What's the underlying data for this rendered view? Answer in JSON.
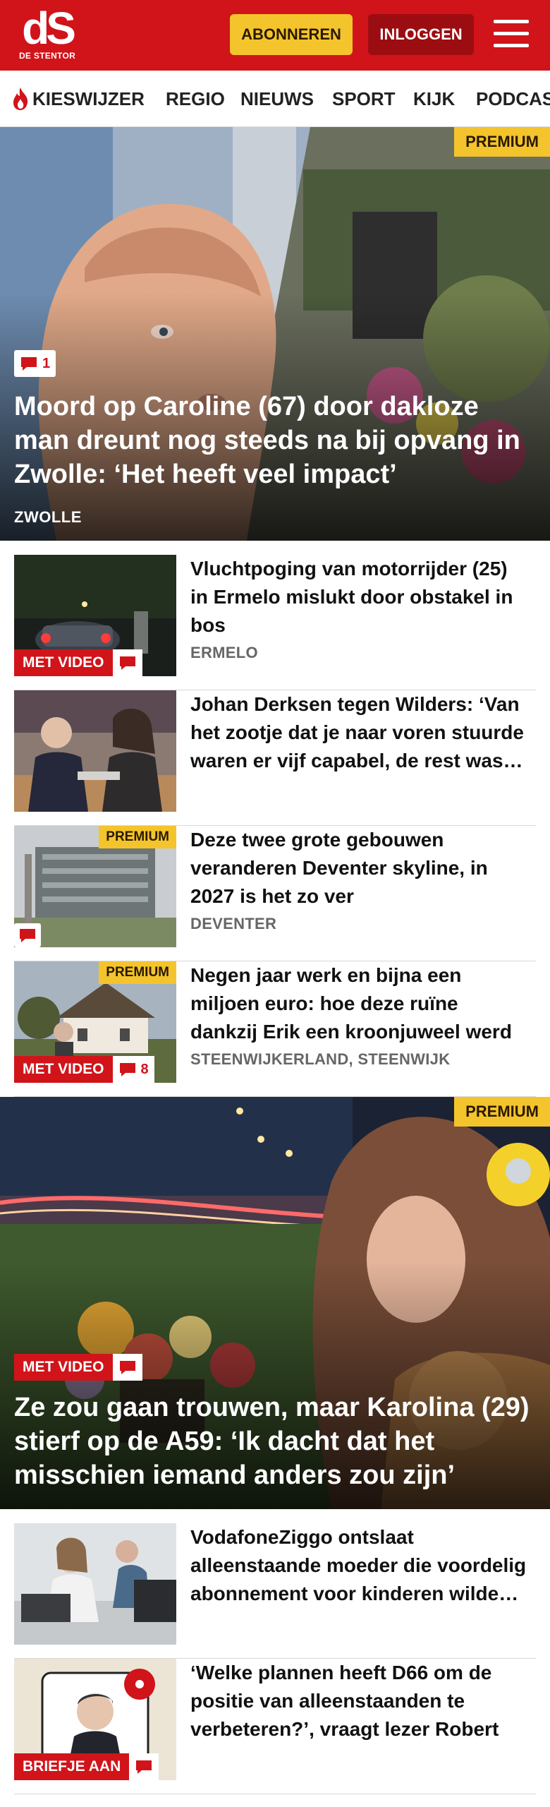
{
  "header": {
    "logo_mark": "dS",
    "logo_brand": "DE STENTOR",
    "subscribe_label": "ABONNEREN",
    "login_label": "INLOGGEN"
  },
  "nav": {
    "items": [
      "KIESWIJZER",
      "REGIO",
      "NIEUWS",
      "SPORT",
      "KIJK",
      "PODCAST"
    ]
  },
  "hero1": {
    "premium": "PREMIUM",
    "comment_count": "1",
    "title": "Moord op Caroline (67) door dakloze man dreunt nog steeds na bij opvang in Zwolle: ‘Het heeft veel impact’",
    "location": "ZWOLLE"
  },
  "articles": [
    {
      "title": "Vluchtpoging van motorrijder (25) in Ermelo mislukt door obstakel in bos",
      "location": "ERMELO",
      "tag": "MET VIDEO"
    },
    {
      "title": "Johan Derksen tegen Wilders: ‘Van het zootje dat je naar voren stuurde waren er vijf capabel, de rest was van nul en generlei waarde’",
      "location": ""
    },
    {
      "title": "Deze twee grote gebouwen veranderen Deventer skyline, in 2027 is het zo ver",
      "location": "DEVENTER",
      "premium": "PREMIUM"
    },
    {
      "title": "Negen jaar werk en bijna een miljoen euro: hoe deze ruïne dankzij Erik een kroonjuweel werd",
      "location": "STEENWIJKERLAND, STEENWIJK",
      "premium": "PREMIUM",
      "tag": "MET VIDEO",
      "comment_count": "8"
    }
  ],
  "hero2": {
    "premium": "PREMIUM",
    "tag": "MET VIDEO",
    "title": "Ze zou gaan trouwen, maar Karolina (29) stierf op de A59: ‘Ik dacht dat het misschien iemand anders zou zijn’"
  },
  "articles2": [
    {
      "title": "VodafoneZiggo ontslaat alleenstaande moeder die voordelig abonnement voor kinderen wilde regelen"
    },
    {
      "title": "‘Welke plannen heeft D66 om de positie van alleenstaanden te verbeteren?’, vraagt lezer Robert",
      "tag": "BRIEFJE AAN"
    }
  ],
  "colors": {
    "brand_red": "#d0141a",
    "premium_yellow": "#f4c42c",
    "login_dark_red": "#9c0d12"
  }
}
